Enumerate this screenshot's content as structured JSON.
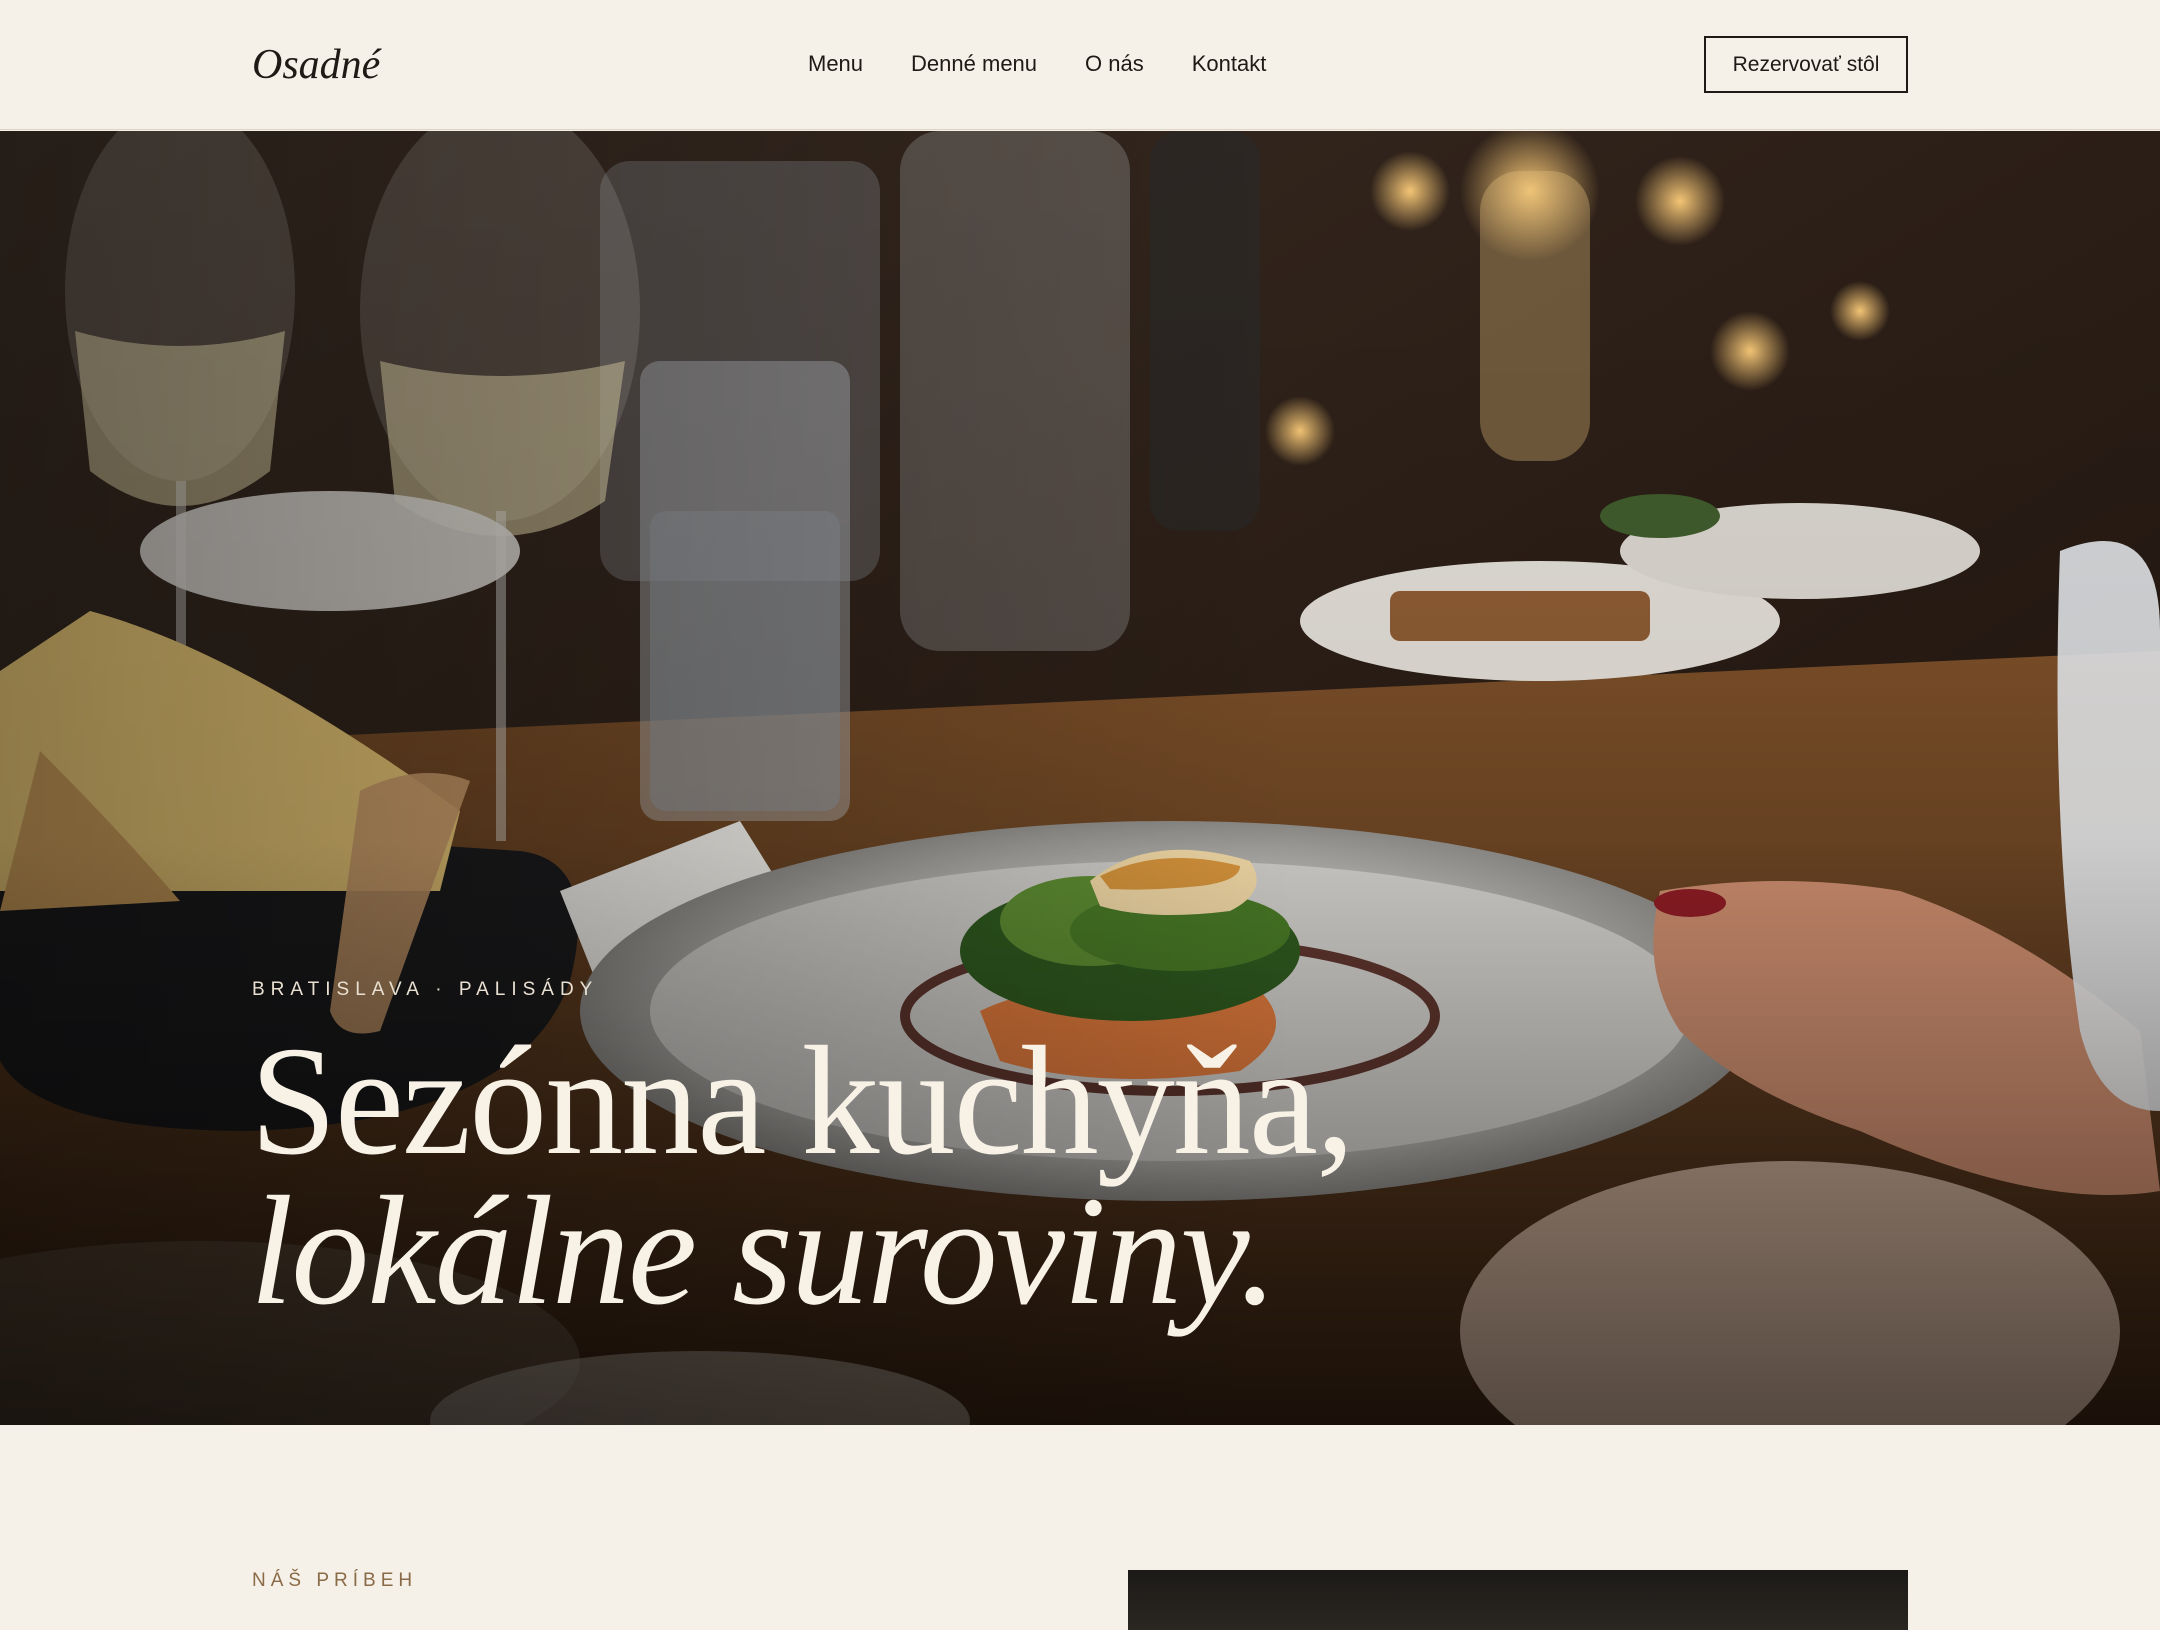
{
  "header": {
    "logo": "Osadné",
    "nav": [
      {
        "label": "Menu"
      },
      {
        "label": "Denné menu"
      },
      {
        "label": "O nás"
      },
      {
        "label": "Kontakt"
      }
    ],
    "cta_label": "Rezervovať stôl"
  },
  "hero": {
    "eyebrow": "BRATISLAVA · PALISÁDY",
    "title_line1": "Sezónna kuchyňa,",
    "title_line2": "lokálne suroviny."
  },
  "story": {
    "eyebrow": "NÁŠ PRÍBEH"
  },
  "colors": {
    "background": "#f5f0e8",
    "text": "#1f1a16",
    "hero_text": "#f7f1e6",
    "accent": "#8a6b47"
  }
}
